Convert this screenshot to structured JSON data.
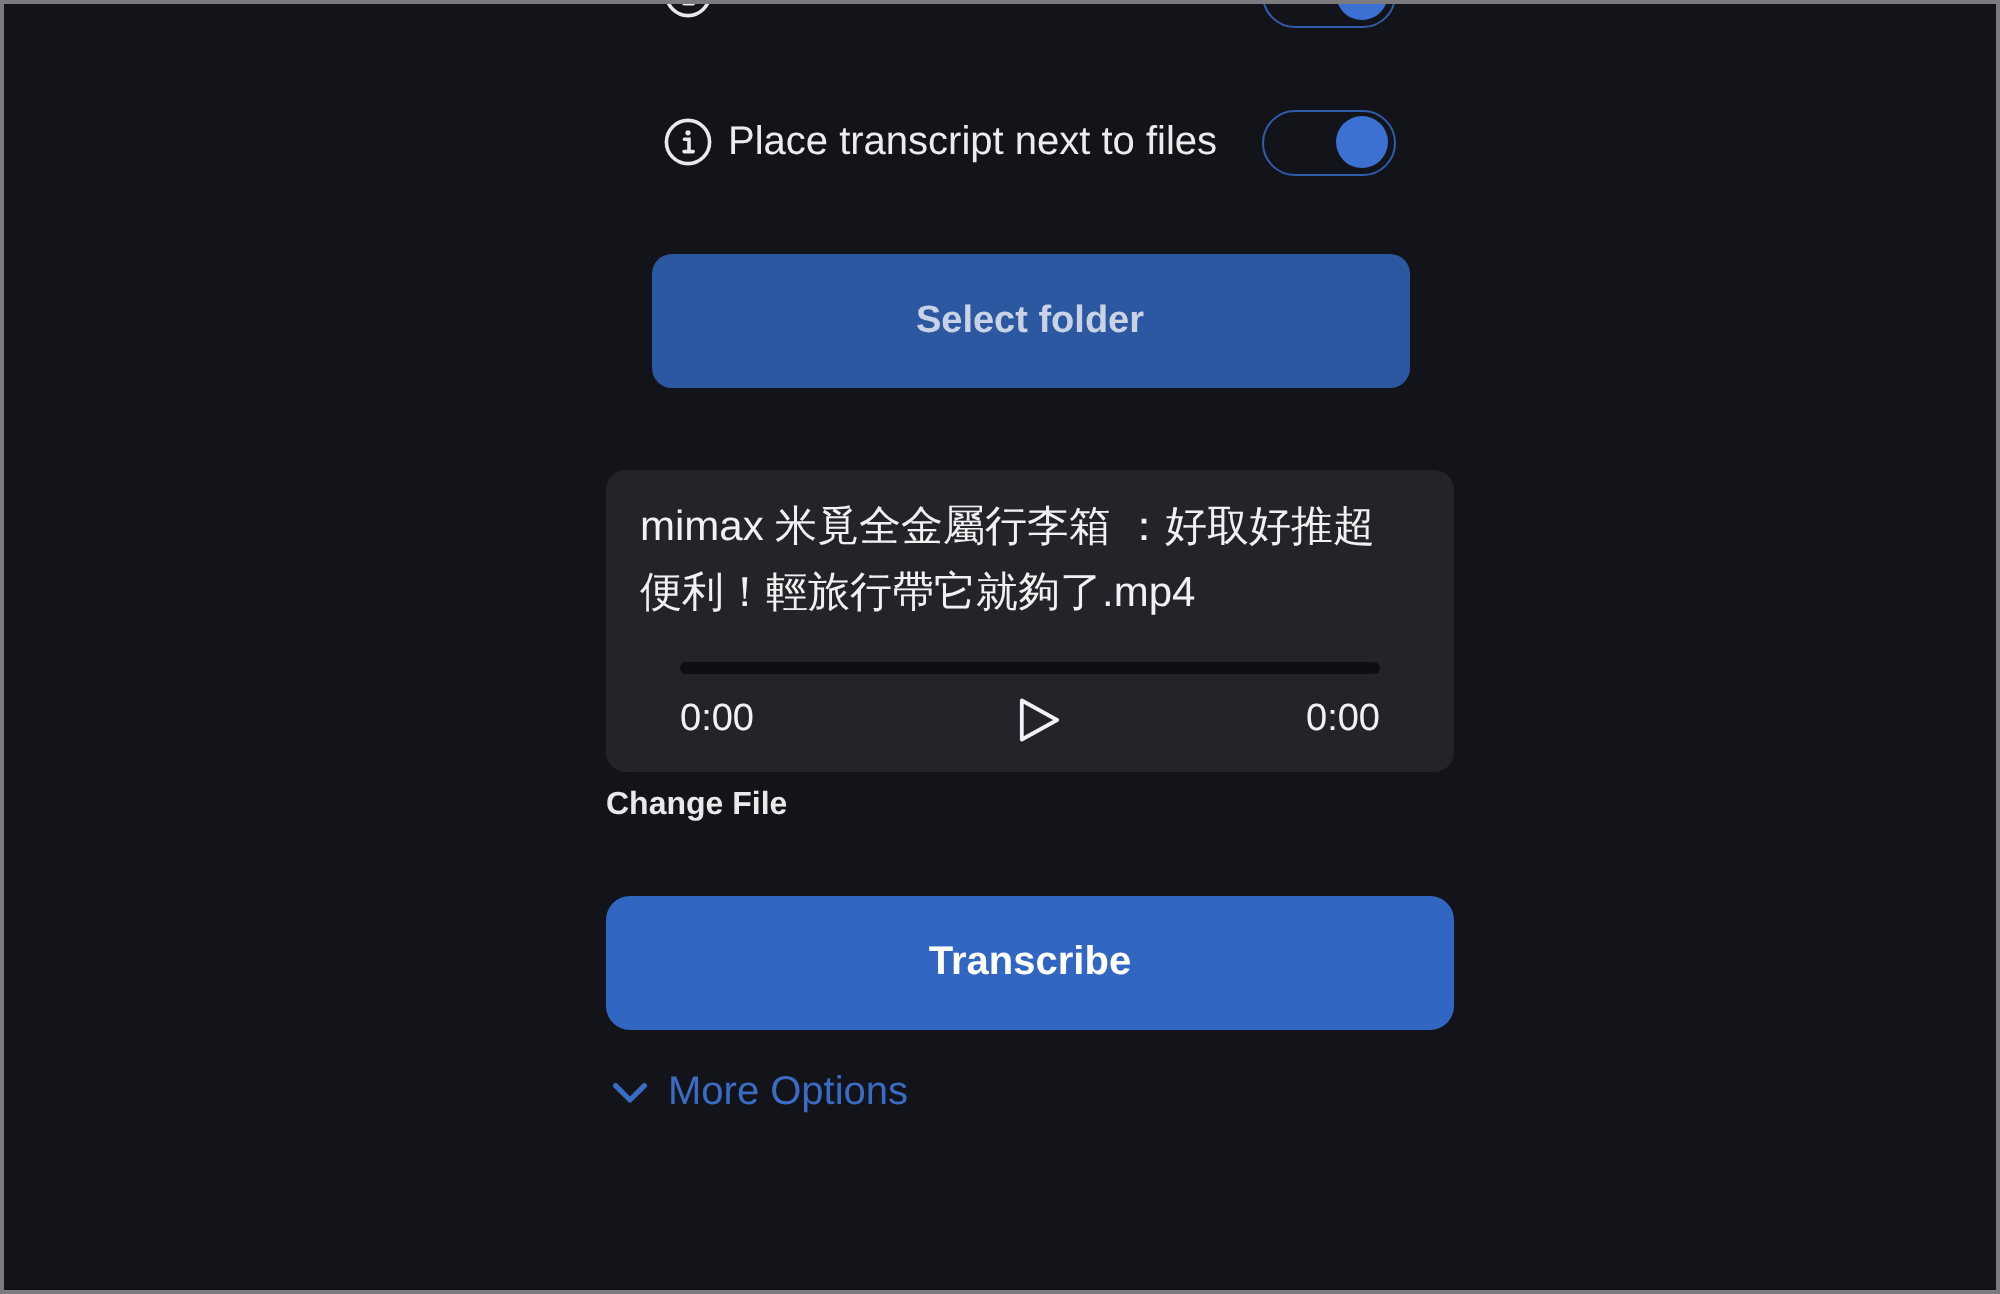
{
  "options": [
    {
      "on": true
    },
    {
      "label": "Place transcript next to files",
      "on": true
    }
  ],
  "select_folder_button": "Select folder",
  "file": {
    "name": "mimax 米覓全金屬行李箱 ：好取好推超便利！輕旅行帶它就夠了.mp4",
    "current_time": "0:00",
    "duration": "0:00"
  },
  "change_file_link": "Change File",
  "transcribe_button": "Transcribe",
  "more_options": {
    "label": "More Options",
    "expanded": false
  }
}
